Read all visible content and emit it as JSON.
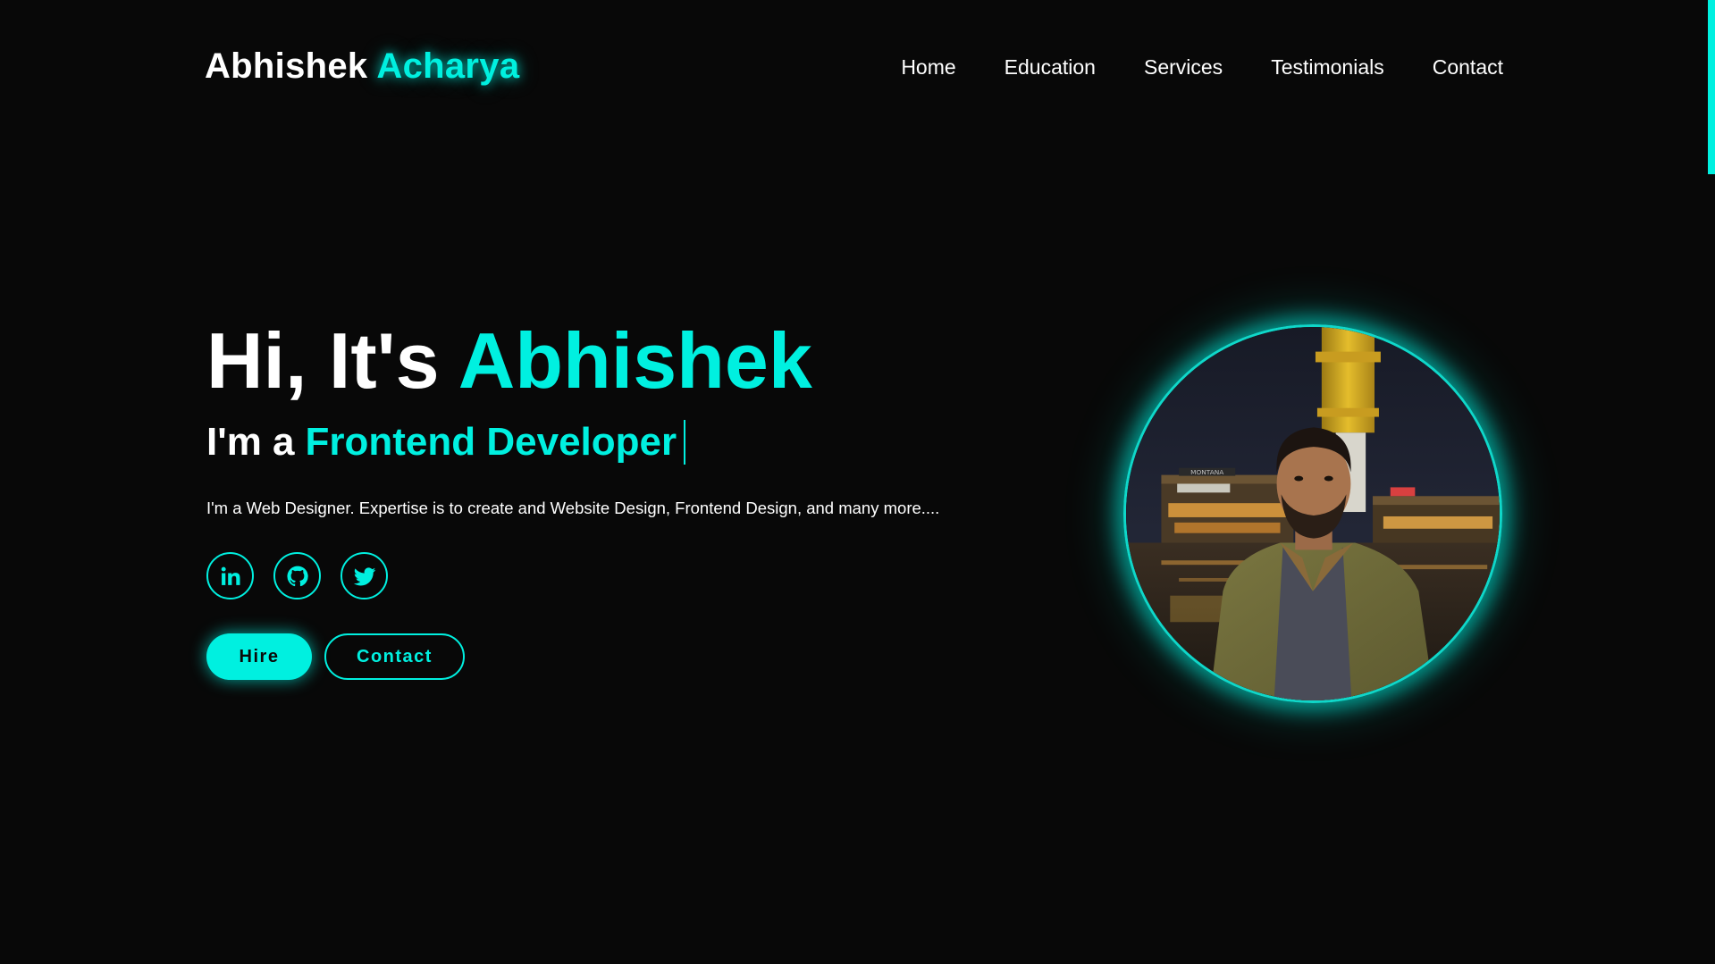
{
  "brand": {
    "first": "Abhishek",
    "last": "Acharya"
  },
  "nav": {
    "items": [
      {
        "label": "Home"
      },
      {
        "label": "Education"
      },
      {
        "label": "Services"
      },
      {
        "label": "Testimonials"
      },
      {
        "label": "Contact"
      }
    ]
  },
  "hero": {
    "greeting": "Hi, It's",
    "name": "Abhishek",
    "role_prefix": "I'm a",
    "role": "Frontend Developer",
    "description": "I'm a Web Designer. Expertise is to create and Website Design, Frontend Design, and many more....",
    "socials": [
      {
        "icon": "linkedin-icon"
      },
      {
        "icon": "github-icon"
      },
      {
        "icon": "twitter-icon"
      }
    ],
    "buttons": {
      "hire": "Hire",
      "contact": "Contact"
    }
  },
  "photo": {
    "sign_text": "MONTANA"
  },
  "colors": {
    "accent": "#00f0e0",
    "background": "#080808",
    "text": "#ffffff"
  }
}
